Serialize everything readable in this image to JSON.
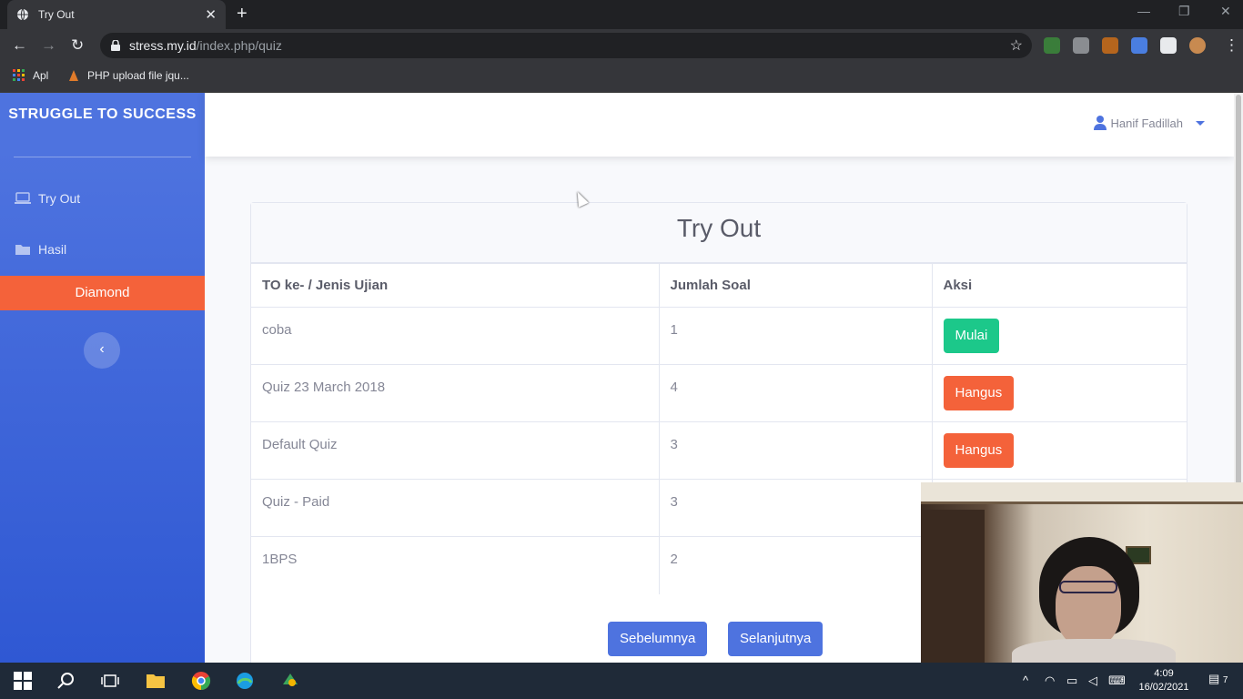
{
  "browser": {
    "tab_title": "Try Out",
    "url_host": "stress.my.id",
    "url_path": "/index.php/quiz",
    "bookmarks": [
      {
        "label": "Apl",
        "icon": "apps-grid-icon"
      },
      {
        "label": "PHP upload file jqu...",
        "icon": "php-icon"
      }
    ]
  },
  "sidebar": {
    "brand": "STRUGGLE TO SUCCESS",
    "items": [
      {
        "label": "Try Out",
        "icon": "laptop-icon"
      },
      {
        "label": "Hasil",
        "icon": "folder-icon"
      }
    ],
    "highlight": "Diamond",
    "toggle_icon": "‹"
  },
  "topbar": {
    "user_name": "Hanif Fadillah"
  },
  "card": {
    "title": "Try Out",
    "columns": [
      "TO ke- / Jenis Ujian",
      "Jumlah Soal",
      "Aksi"
    ],
    "rows": [
      {
        "name": "coba",
        "count": "1",
        "action": "Mulai",
        "action_color": "#1cc88a"
      },
      {
        "name": "Quiz 23 March 2018",
        "count": "4",
        "action": "Hangus",
        "action_color": "#f4623a"
      },
      {
        "name": "Default Quiz",
        "count": "3",
        "action": "Hangus",
        "action_color": "#f4623a"
      },
      {
        "name": "Quiz - Paid",
        "count": "3",
        "action": "",
        "action_color": ""
      },
      {
        "name": "1BPS",
        "count": "2",
        "action": "",
        "action_color": ""
      }
    ],
    "prev_label": "Sebelumnya",
    "next_label": "Selanjutnya"
  },
  "taskbar": {
    "time": "4:09",
    "date": "16/02/2021",
    "notification_count": "7"
  },
  "colors": {
    "sidebar": "#4e73df",
    "accent_orange": "#f4623a",
    "success": "#1cc88a",
    "primary": "#4e73df"
  }
}
